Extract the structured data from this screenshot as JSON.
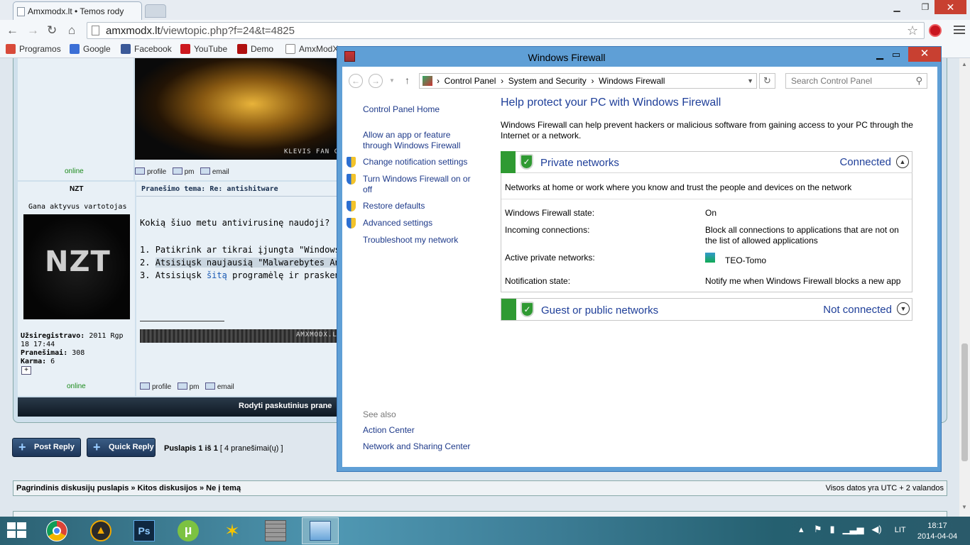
{
  "chrome": {
    "tab_title": "Amxmodx.lt • Temos rody",
    "url_host": "amxmodx.lt",
    "url_path": "/viewtopic.php?f=24&t=4825",
    "bookmarks": [
      {
        "label": "Programos",
        "color": "#d84a3a"
      },
      {
        "label": "Google",
        "color": "#3b6fd6"
      },
      {
        "label": "Facebook",
        "color": "#3b5998"
      },
      {
        "label": "YouTube",
        "color": "#cc181e"
      },
      {
        "label": "Demo",
        "color": "#b01010"
      },
      {
        "label": "AmxModX",
        "color": "#ffffff"
      }
    ]
  },
  "forum": {
    "post1": {
      "online": "online",
      "links": [
        "profile",
        "pm",
        "email"
      ],
      "banner_caption": "KLEVIS FAN CL"
    },
    "post2": {
      "author": "NZT",
      "rank": "Gana aktyvus vartotojas",
      "avatar_text": "NZT",
      "registered_label": "Užsiregistravo:",
      "registered_value": "2011 Rgp 18 17:44",
      "posts_label": "Pranešimai:",
      "posts_value": "308",
      "karma_label": "Karma:",
      "karma_value": "6",
      "online": "online",
      "subject_label": "Pranešimo tema:",
      "subject_value": "Re: antishitware",
      "question": "Kokią šiuo metu antivirusinę naudoji?",
      "steps": [
        {
          "num": "1.",
          "text": "Patikrink ar tikrai įjungta \"Windows Firewall\""
        },
        {
          "num": "2.",
          "text": "Atsisiųsk naujausią \"Malwarebytes Anti-Malw"
        },
        {
          "num": "3.",
          "pre": "Atsisiųsk ",
          "link": "šitą",
          "post": " programėlę ir praskenuok."
        }
      ],
      "signature_text": "AMXMODX.LT",
      "links": [
        "profile",
        "pm",
        "email"
      ]
    },
    "footer_bar_text": "Rodyti paskutinius prane",
    "buttons": {
      "post_reply": "Post Reply",
      "quick_reply": "Quick Reply"
    },
    "pagination": {
      "label": "Puslapis 1 iš 1",
      "count": "[ 4 pranešimai(ų) ]"
    },
    "breadcrumb": {
      "items": [
        "Pagrindinis diskusijų puslapis",
        "Kitos diskusijos",
        "Ne į temą"
      ],
      "sep": " » ",
      "timezone": "Visos datos yra UTC + 2 valandos"
    }
  },
  "firewall": {
    "title": "Windows Firewall",
    "breadcrumb": [
      "Control Panel",
      "System and Security",
      "Windows Firewall"
    ],
    "search_placeholder": "Search Control Panel",
    "sidebar": {
      "home": "Control Panel Home",
      "allow_app": "Allow an app or feature through Windows Firewall",
      "change_notif": "Change notification settings",
      "turn_onoff": "Turn Windows Firewall on or off",
      "restore": "Restore defaults",
      "advanced": "Advanced settings",
      "troubleshoot": "Troubleshoot my network",
      "see_also": "See also",
      "action_center": "Action Center",
      "network_sharing": "Network and Sharing Center"
    },
    "heading": "Help protect your PC with Windows Firewall",
    "description": "Windows Firewall can help prevent hackers or malicious software from gaining access to your PC through the Internet or a network.",
    "private": {
      "title": "Private networks",
      "status": "Connected",
      "description": "Networks at home or work where you know and trust the people and devices on the network",
      "rows": [
        {
          "label": "Windows Firewall state:",
          "value": "On"
        },
        {
          "label": "Incoming connections:",
          "value": "Block all connections to applications that are not on the list of allowed applications"
        },
        {
          "label": "Active private networks:",
          "value": "TEO-Tomo"
        },
        {
          "label": "Notification state:",
          "value": "Notify me when Windows Firewall blocks a new app"
        }
      ]
    },
    "public": {
      "title": "Guest or public networks",
      "status": "Not connected"
    },
    "colors": {
      "accent": "#1f3f99",
      "green": "#2f9a32",
      "frame": "#5f9fd6",
      "close": "#c84031"
    }
  },
  "taskbar": {
    "apps": [
      {
        "name": "chrome-icon"
      },
      {
        "name": "aimp-icon"
      },
      {
        "name": "photoshop-icon",
        "label": "Ps"
      },
      {
        "name": "utorrent-icon"
      },
      {
        "name": "keyboard-tool-icon"
      },
      {
        "name": "firewall-app-icon"
      },
      {
        "name": "control-panel-icon"
      }
    ],
    "language": "LIT",
    "time": "18:17",
    "date": "2014-04-04"
  }
}
